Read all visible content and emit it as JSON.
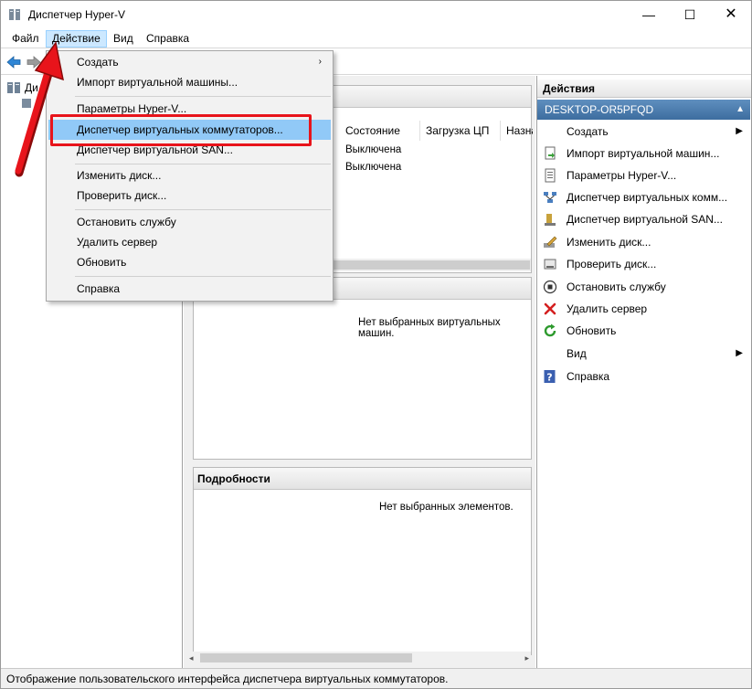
{
  "window": {
    "title": "Диспетчер Hyper-V",
    "minimize": "—",
    "maximize": "☐",
    "close": "✕"
  },
  "menubar": {
    "items": [
      {
        "label": "Файл"
      },
      {
        "label": "Действие"
      },
      {
        "label": "Вид"
      },
      {
        "label": "Справка"
      }
    ]
  },
  "tree": {
    "root_label": "Ди"
  },
  "vm_panel": {
    "columns": [
      "Состояние",
      "Загрузка ЦП",
      "Назна"
    ],
    "rows": [
      {
        "state": "Выключена"
      },
      {
        "state": "Выключена"
      }
    ]
  },
  "snapshots_panel": {
    "empty_text": "Нет выбранных виртуальных машин."
  },
  "details_panel": {
    "title": "Подробности",
    "empty_text": "Нет выбранных элементов."
  },
  "actions": {
    "title": "Действия",
    "host": "DESKTOP-OR5PFQD",
    "items": [
      {
        "label": "Создать",
        "icon": "blank",
        "submenu": true
      },
      {
        "label": "Импорт виртуальной машин...",
        "icon": "import-icon"
      },
      {
        "label": "Параметры Hyper-V...",
        "icon": "settings-page-icon"
      },
      {
        "label": "Диспетчер виртуальных комм...",
        "icon": "network-switch-icon"
      },
      {
        "label": "Диспетчер виртуальной SAN...",
        "icon": "san-icon"
      },
      {
        "label": "Изменить диск...",
        "icon": "edit-disk-icon"
      },
      {
        "label": "Проверить диск...",
        "icon": "inspect-disk-icon"
      },
      {
        "label": "Остановить службу",
        "icon": "stop-icon"
      },
      {
        "label": "Удалить сервер",
        "icon": "delete-icon"
      },
      {
        "label": "Обновить",
        "icon": "refresh-icon"
      },
      {
        "label": "Вид",
        "icon": "blank",
        "submenu": true
      },
      {
        "label": "Справка",
        "icon": "help-icon"
      }
    ]
  },
  "dropdown": {
    "items": [
      {
        "label": "Создать",
        "submenu": true
      },
      {
        "label": "Импорт виртуальной машины..."
      },
      {
        "label": "Параметры Hyper-V..."
      },
      {
        "label": "Диспетчер виртуальных коммутаторов..."
      },
      {
        "label": "Диспетчер виртуальной SAN..."
      },
      {
        "label": "Изменить диск..."
      },
      {
        "label": "Проверить диск..."
      },
      {
        "label": "Остановить службу"
      },
      {
        "label": "Удалить сервер"
      },
      {
        "label": "Обновить"
      },
      {
        "label": "Справка"
      }
    ]
  },
  "statusbar": {
    "text": "Отображение пользовательского интерфейса диспетчера виртуальных коммутаторов."
  },
  "colors": {
    "menu_highlight": "#91c9f7",
    "host_header": "#3d6d9f",
    "annotation_red": "#e8141b"
  }
}
